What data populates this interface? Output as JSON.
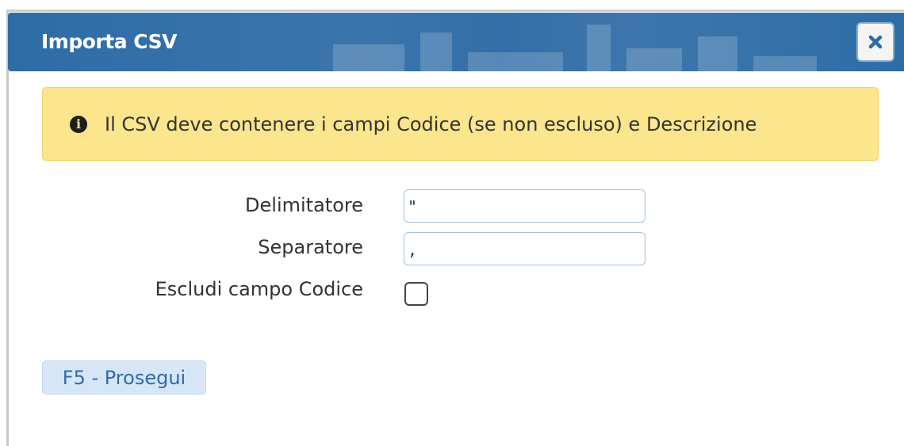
{
  "dialog": {
    "title": "Importa CSV",
    "close_icon": "close-icon"
  },
  "alert": {
    "icon": "info-icon",
    "icon_glyph": "i",
    "text": "Il CSV deve contenere i campi Codice (se non escluso) e Descrizione"
  },
  "form": {
    "delimiter_label": "Delimitatore",
    "delimiter_value": "\"",
    "separator_label": "Separatore",
    "separator_value": ",",
    "exclude_code_label": "Escludi campo Codice",
    "exclude_code_checked": false
  },
  "actions": {
    "proceed_label": "F5 - Prosegui"
  },
  "colors": {
    "titlebar": "#2f6ca6",
    "alert_bg": "#fbe58d",
    "button_bg": "#d6e6f7",
    "button_text": "#2f6ca6"
  }
}
